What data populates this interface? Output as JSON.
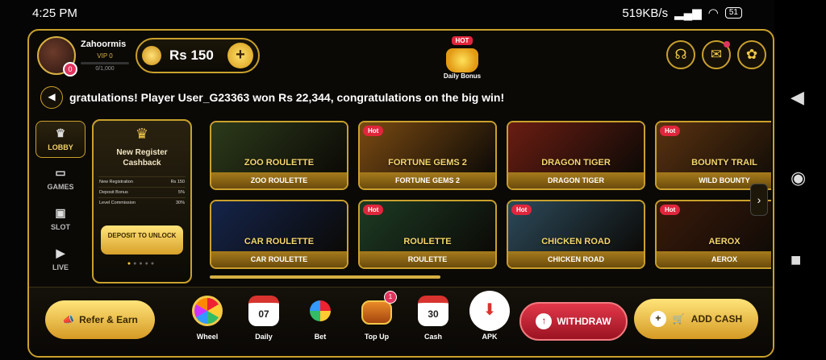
{
  "status": {
    "time": "4:25 PM",
    "speed": "519KB/s",
    "battery": "51"
  },
  "header": {
    "username": "Zahoormis",
    "vip": "VIP 0",
    "xp": "0/1,000",
    "notif_count": "0",
    "balance": "Rs 150",
    "daily_hot": "HOT",
    "daily_label": "Daily Bonus",
    "icons": [
      "headset-icon",
      "mail-icon",
      "settings-icon"
    ]
  },
  "marquee": {
    "text": "gratulations! Player User_G23363 won Rs 22,344, congratulations on the big win!"
  },
  "sidenav": [
    {
      "label": "LOBBY",
      "icon": "crown-icon"
    },
    {
      "label": "GAMES",
      "icon": "gamepad-icon"
    },
    {
      "label": "SLOT",
      "icon": "slot-icon"
    },
    {
      "label": "LIVE",
      "icon": "play-icon"
    }
  ],
  "promo": {
    "title": "New Register Cashback",
    "rows": [
      {
        "k": "New Registration",
        "v": "Rs 150"
      },
      {
        "k": "Deposit Bonus",
        "v": "5%"
      },
      {
        "k": "Level Commission",
        "v": "30%"
      }
    ],
    "button": "DEPOSIT TO UNLOCK"
  },
  "games": [
    {
      "name": "ZOO ROULETTE",
      "logo": "ZOO ROULETTE",
      "hot": "",
      "color": "#2c3a1a"
    },
    {
      "name": "FORTUNE GEMS 2",
      "logo": "FORTUNE GEMS 2",
      "hot": "Hot",
      "color": "#7a4a12"
    },
    {
      "name": "DRAGON TIGER",
      "logo": "DRAGON TIGER",
      "hot": "",
      "color": "#6a1d12"
    },
    {
      "name": "WILD BOUNTY",
      "logo": "BOUNTY TRAIL",
      "hot": "Hot",
      "color": "#5a3210"
    },
    {
      "name": "CAR ROULETTE",
      "logo": "CAR ROULETTE",
      "hot": "",
      "color": "#14244a"
    },
    {
      "name": "ROULETTE",
      "logo": "ROULETTE",
      "hot": "Hot",
      "color": "#1d3b24"
    },
    {
      "name": "CHICKEN ROAD",
      "logo": "CHICKEN ROAD",
      "hot": "Hot",
      "color": "#2c4a5a"
    },
    {
      "name": "AEROX",
      "logo": "AEROX",
      "hot": "Hot",
      "color": "#3a1a0a"
    }
  ],
  "bottom": {
    "refer": "Refer & Earn",
    "items": [
      {
        "label": "Wheel",
        "text": "",
        "badge": ""
      },
      {
        "label": "Daily",
        "text": "07",
        "badge": ""
      },
      {
        "label": "Bet",
        "text": "",
        "badge": ""
      },
      {
        "label": "Top Up",
        "text": "",
        "badge": "1"
      },
      {
        "label": "Cash",
        "text": "30",
        "badge": ""
      },
      {
        "label": "APK",
        "text": "",
        "badge": ""
      }
    ],
    "withdraw": "WITHDRAW",
    "addcash": "ADD CASH"
  }
}
